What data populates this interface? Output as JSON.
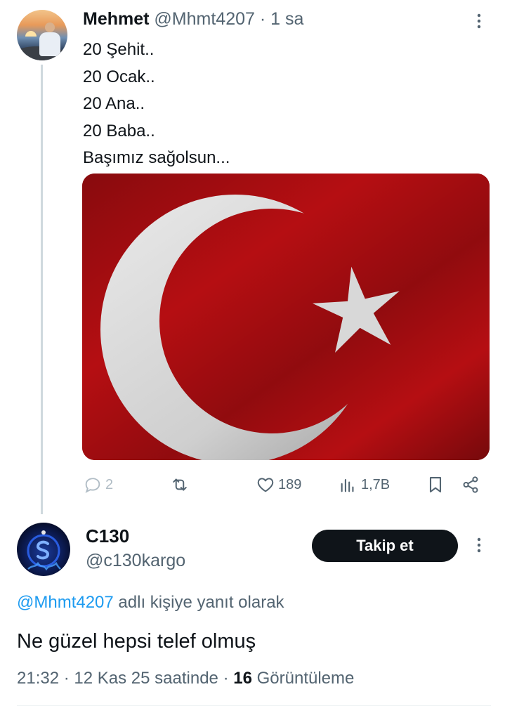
{
  "parent_tweet": {
    "author_name": "Mehmet",
    "handle": "@Mhmt4207",
    "separator": "·",
    "time": "1 sa",
    "lines": [
      "20 Şehit..",
      "20 Ocak..",
      "20 Ana..",
      "20 Baba..",
      "Başımız sağolsun..."
    ],
    "actions": {
      "reply_count": "2",
      "retweet_count": "",
      "like_count": "189",
      "views_count": "1,7B"
    },
    "media": {
      "description_icon": "turkish-flag-image",
      "flag_red": "#c8102e",
      "flag_white": "#e6e6e6"
    }
  },
  "reply_tweet": {
    "author_name": "C130",
    "handle": "@c130kargo",
    "follow_label": "Takip et",
    "reply_to_mention": "@Mhmt4207",
    "reply_to_suffix": " adlı kişiye yanıt olarak",
    "text": "Ne güzel hepsi telef olmuş",
    "time": "21:32",
    "date_text": "12 Kas 25 saatinde",
    "views_count": "16",
    "views_label": "Görüntüleme",
    "separator": "·"
  },
  "colors": {
    "text_primary": "#0f1419",
    "text_secondary": "#536471",
    "accent_blue": "#1d9bf0",
    "button_bg": "#0f1419"
  }
}
